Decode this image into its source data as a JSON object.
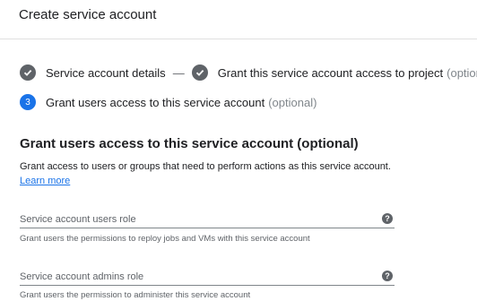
{
  "header": {
    "title": "Create service account"
  },
  "steps": [
    {
      "label": "Service account details",
      "status": "complete",
      "icon": "check-circle-icon"
    },
    {
      "label": "Grant this service account access to project",
      "optional": "(optional)",
      "status": "complete",
      "icon": "check-circle-icon"
    },
    {
      "number": "3",
      "label": "Grant users access to this service account",
      "optional": "(optional)",
      "status": "active"
    }
  ],
  "stepper": {
    "separator": "—"
  },
  "section": {
    "title": "Grant users access to this service account (optional)",
    "description": "Grant access to users or groups that need to perform actions as this service account.",
    "learn_more": "Learn more"
  },
  "fields": [
    {
      "label": "Service account users role",
      "value": "",
      "hint": "Grant users the permissions to reploy jobs and VMs with this service account",
      "help_icon": "help-icon"
    },
    {
      "label": "Service account admins role",
      "value": "",
      "hint": "Grant users the permission to administer this service account",
      "help_icon": "help-icon"
    }
  ],
  "colors": {
    "accent": "#1a73e8",
    "complete": "#5f6368",
    "text": "#202124"
  }
}
